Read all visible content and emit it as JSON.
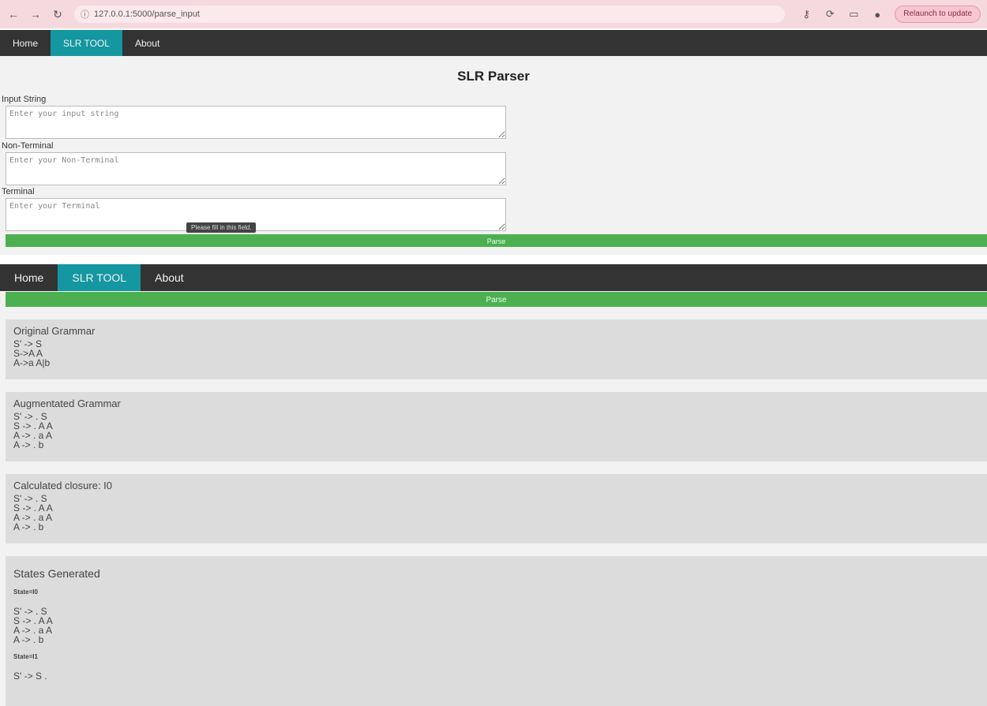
{
  "browser": {
    "url": "127.0.0.1:5000/parse_input",
    "relaunch_label": "Relaunch to update"
  },
  "nav": {
    "items": [
      {
        "label": "Home"
      },
      {
        "label": "SLR TOOL"
      },
      {
        "label": "About"
      }
    ]
  },
  "form": {
    "title": "SLR Parser",
    "input_label": "Input String",
    "input_placeholder": "Enter your input string",
    "nonterminal_label": "Non-Terminal",
    "nonterminal_placeholder": "Enter your Non-Terminal",
    "terminal_label": "Terminal",
    "terminal_placeholder": "Enter your Terminal",
    "tooltip": "Please fill in this field.",
    "parse_label": "Parse"
  },
  "results": {
    "parse_label": "Parse",
    "original": {
      "heading": "Original Grammar",
      "lines": [
        "S' -> S",
        "S->A A",
        "A->a A|b"
      ]
    },
    "augmented": {
      "heading": "Augmentated Grammar",
      "lines": [
        "S' -> . S",
        "S -> . A A",
        "A -> . a A",
        "A -> . b"
      ]
    },
    "closure": {
      "heading": "Calculated closure: I0",
      "lines": [
        "S' -> . S",
        "S -> . A A",
        "A -> . a A",
        "A -> . b"
      ]
    },
    "states": {
      "heading": "States Generated",
      "state0_label": "State=I0",
      "state0_lines": [
        "S' -> . S",
        "S -> . A A",
        "A -> . a A",
        "A -> . b"
      ],
      "state1_label": "State=I1",
      "state1_lines": [
        "S' -> S ."
      ]
    }
  }
}
